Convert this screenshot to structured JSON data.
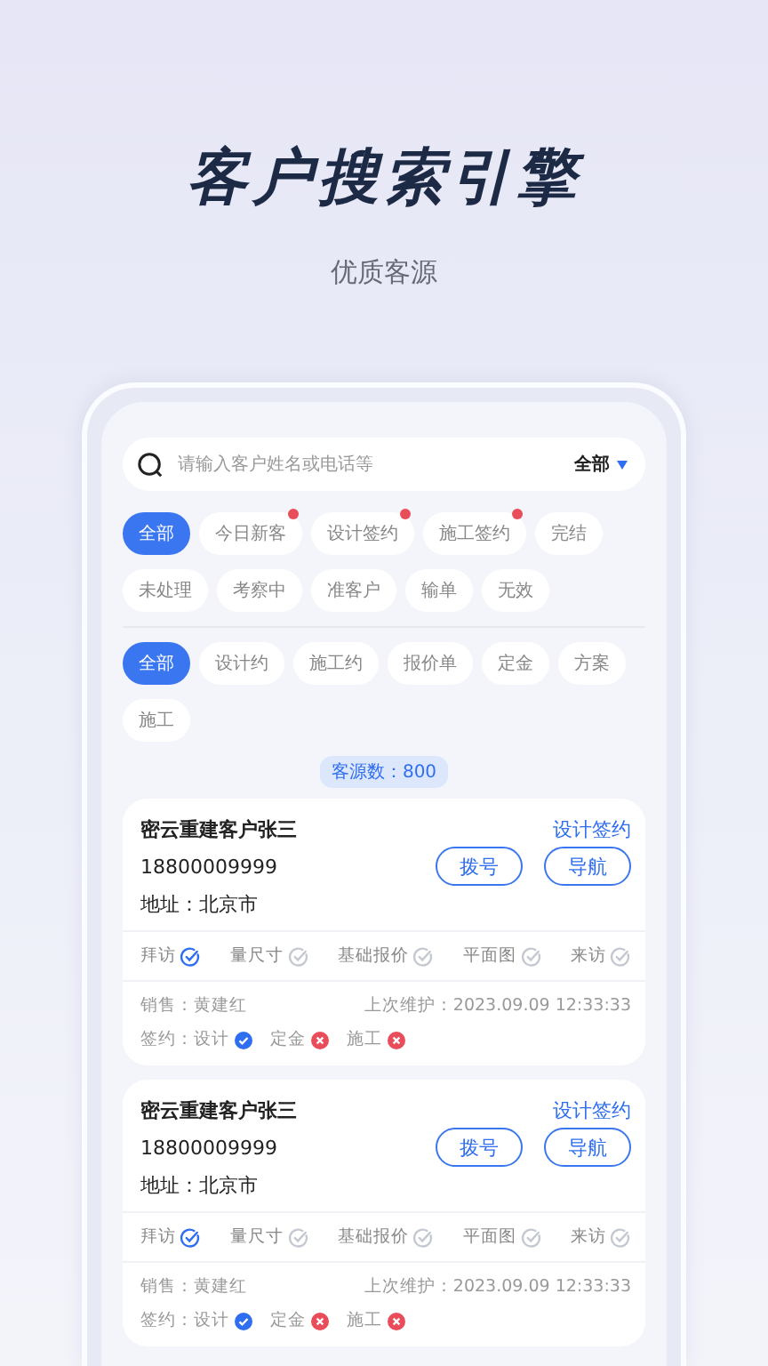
{
  "headline": "客户搜索引擎",
  "subtitle": "优质客源",
  "search": {
    "placeholder": "请输入客户姓名或电话等",
    "scope": "全部"
  },
  "filter_groups": [
    {
      "chips": [
        {
          "label": "全部",
          "selected": true,
          "dot": false
        },
        {
          "label": "今日新客",
          "selected": false,
          "dot": true
        },
        {
          "label": "设计签约",
          "selected": false,
          "dot": true
        },
        {
          "label": "施工签约",
          "selected": false,
          "dot": true
        },
        {
          "label": "完结",
          "selected": false,
          "dot": false
        },
        {
          "label": "未处理",
          "selected": false,
          "dot": false
        },
        {
          "label": "考察中",
          "selected": false,
          "dot": false
        },
        {
          "label": "准客户",
          "selected": false,
          "dot": false
        },
        {
          "label": "输单",
          "selected": false,
          "dot": false
        },
        {
          "label": "无效",
          "selected": false,
          "dot": false
        }
      ]
    },
    {
      "chips": [
        {
          "label": "全部",
          "selected": true,
          "dot": false
        },
        {
          "label": "设计约",
          "selected": false,
          "dot": false
        },
        {
          "label": "施工约",
          "selected": false,
          "dot": false
        },
        {
          "label": "报价单",
          "selected": false,
          "dot": false
        },
        {
          "label": "定金",
          "selected": false,
          "dot": false
        },
        {
          "label": "方案",
          "selected": false,
          "dot": false
        },
        {
          "label": "施工",
          "selected": false,
          "dot": false
        }
      ]
    }
  ],
  "count": "客源数：800",
  "customers": [
    {
      "name": "密云重建客户张三",
      "status": "设计签约",
      "phone": "18800009999",
      "call": "拨号",
      "navigate": "导航",
      "address": "地址：北京市",
      "steps": [
        {
          "label": "拜访",
          "checked": true
        },
        {
          "label": "量尺寸",
          "checked": false
        },
        {
          "label": "基础报价",
          "checked": false
        },
        {
          "label": "平面图",
          "checked": false
        },
        {
          "label": "来访",
          "checked": false
        }
      ],
      "sales": "销售：黄建红",
      "last_maintained": "上次维护：2023.09.09 12:33:33",
      "sign_label": "签约：",
      "signs": [
        {
          "label": "设计",
          "done": true
        },
        {
          "label": "定金",
          "done": false
        },
        {
          "label": "施工",
          "done": false
        }
      ]
    },
    {
      "name": "密云重建客户张三",
      "status": "设计签约",
      "phone": "18800009999",
      "call": "拨号",
      "navigate": "导航",
      "address": "地址：北京市",
      "steps": [
        {
          "label": "拜访",
          "checked": true
        },
        {
          "label": "量尺寸",
          "checked": false
        },
        {
          "label": "基础报价",
          "checked": false
        },
        {
          "label": "平面图",
          "checked": false
        },
        {
          "label": "来访",
          "checked": false
        }
      ],
      "sales": "销售：黄建红",
      "last_maintained": "上次维护：2023.09.09 12:33:33",
      "sign_label": "签约：",
      "signs": [
        {
          "label": "设计",
          "done": true
        },
        {
          "label": "定金",
          "done": false
        },
        {
          "label": "施工",
          "done": false
        }
      ]
    }
  ]
}
